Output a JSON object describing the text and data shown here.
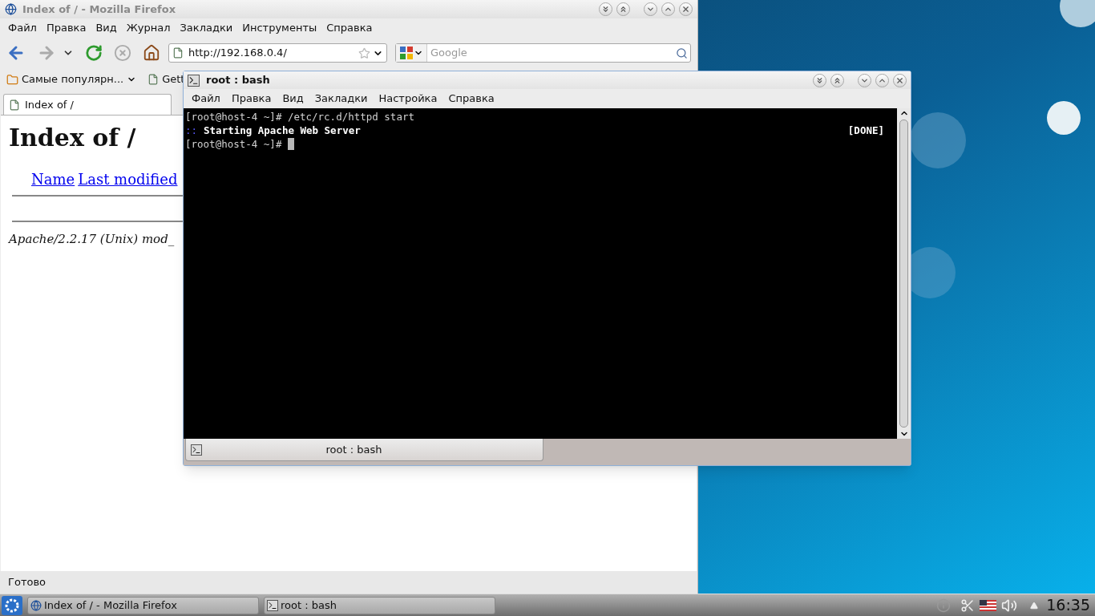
{
  "firefox": {
    "title": "Index of / - Mozilla Firefox",
    "menu": [
      "Файл",
      "Правка",
      "Вид",
      "Журнал",
      "Закладки",
      "Инструменты",
      "Справка"
    ],
    "url": "http://192.168.0.4/",
    "search": {
      "placeholder": "Google"
    },
    "bookmarks": [
      "Самые популярн...",
      "Gett"
    ],
    "tabs": [
      {
        "label": "Index of /",
        "selected": true
      }
    ],
    "page": {
      "heading": "Index of /",
      "columns": [
        "Name",
        "Last modified"
      ],
      "address": "Apache/2.2.17 (Unix) mod_"
    },
    "status_bar": "Готово"
  },
  "terminal": {
    "title": "root : bash",
    "menu": [
      "Файл",
      "Правка",
      "Вид",
      "Закладки",
      "Настройка",
      "Справка"
    ],
    "lines": [
      {
        "kind": "command",
        "text": "[root@host-4 ~]# /etc/rc.d/httpd start"
      },
      {
        "kind": "status",
        "prefix": "::",
        "text": "Starting Apache Web Server",
        "status": "[DONE]"
      },
      {
        "kind": "prompt",
        "text": "[root@host-4 ~]#"
      }
    ],
    "tabs": [
      {
        "label": "root : bash",
        "selected": true
      }
    ]
  },
  "taskbar": {
    "tasks": [
      {
        "label": "Index of / - Mozilla Firefox",
        "selected": false
      },
      {
        "label": "root : bash",
        "selected": false
      }
    ],
    "clock": "16:35"
  }
}
